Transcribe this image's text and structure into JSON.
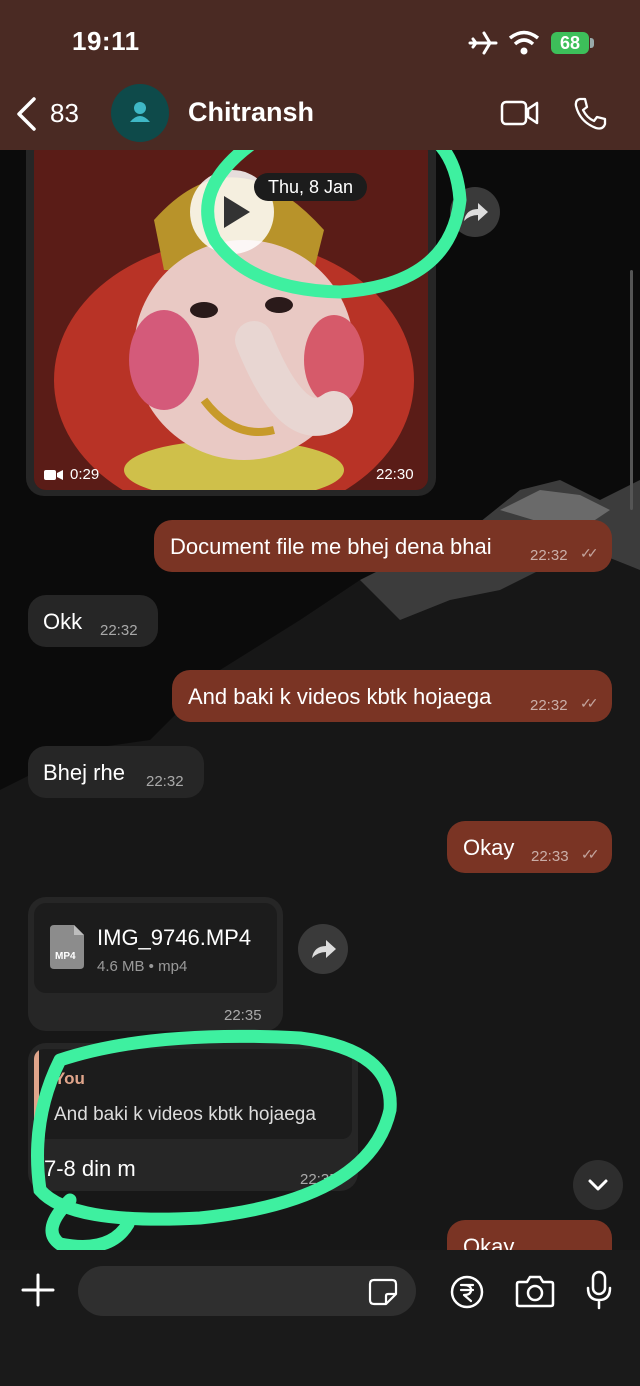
{
  "status": {
    "time": "19:11",
    "battery": "68"
  },
  "header": {
    "back_count": "83",
    "contact": "Chitransh"
  },
  "chat": {
    "date_pill": "Thu, 8 Jan",
    "video": {
      "duration": "0:29",
      "time": "22:30"
    },
    "messages": [
      {
        "text": "Document file me bhej dena bhai",
        "time": "22:32"
      },
      {
        "text": "Okk",
        "time": "22:32"
      },
      {
        "text": "And baki k videos kbtk hojaega",
        "time": "22:32"
      },
      {
        "text": "Bhej rhe",
        "time": "22:32"
      },
      {
        "text": "Okay",
        "time": "22:33"
      }
    ],
    "file": {
      "name": "IMG_9746.MP4",
      "meta": "4.6 MB • mp4",
      "badge": "MP4",
      "time": "22:35"
    },
    "reply": {
      "author": "You",
      "quoted": "And baki k videos kbtk hojaega",
      "text": "7-8 din m",
      "time": "22:35"
    },
    "partial": {
      "text": "Okay"
    }
  },
  "colors": {
    "header_bg": "#4a2a23",
    "outgoing": "#7a3424",
    "incoming": "#262626",
    "highlight": "#3ef0a0"
  }
}
